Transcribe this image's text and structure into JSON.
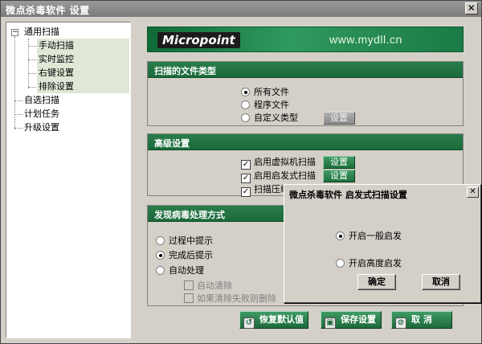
{
  "window": {
    "title": "微点杀毒软件    设置"
  },
  "tree": {
    "root": "通用扫描",
    "children": [
      "手动扫描",
      "实时监控",
      "右键设置",
      "排除设置"
    ],
    "others": [
      "自选扫描",
      "计划任务",
      "升级设置"
    ]
  },
  "banner": {
    "logo": "Micropoint",
    "url": "www.mydll.cn"
  },
  "file_types": {
    "title": "扫描的文件类型",
    "options": [
      "所有文件",
      "程序文件",
      "自定义类型"
    ],
    "selected_index": 0,
    "set_label": "设置"
  },
  "advanced": {
    "title": "高级设置",
    "items": [
      {
        "label": "启用虚拟机扫描",
        "checked": true,
        "button": "设置"
      },
      {
        "label": "启用启发式扫描",
        "checked": true,
        "button": "设置"
      },
      {
        "label": "扫描压缩",
        "checked": true
      }
    ]
  },
  "virus_handling": {
    "title": "发现病毒处理方式",
    "options": [
      "过程中提示",
      "完成后提示",
      "自动处理"
    ],
    "selected_index": 1,
    "sub_options": [
      "自动清除",
      "如果清除失败则删除"
    ]
  },
  "bottom_buttons": {
    "restore": "恢复默认值",
    "save": "保存设置",
    "cancel": "取    消"
  },
  "dialog": {
    "title": "微点杀毒软件  启发式扫描设置",
    "options": [
      "开启一般启发",
      "开启高度启发"
    ],
    "selected_index": 0,
    "ok": "确定",
    "cancel": "取消"
  },
  "colors": {
    "accent_green": "#1f6f3d",
    "tree_selection": "#dfe8d6"
  }
}
